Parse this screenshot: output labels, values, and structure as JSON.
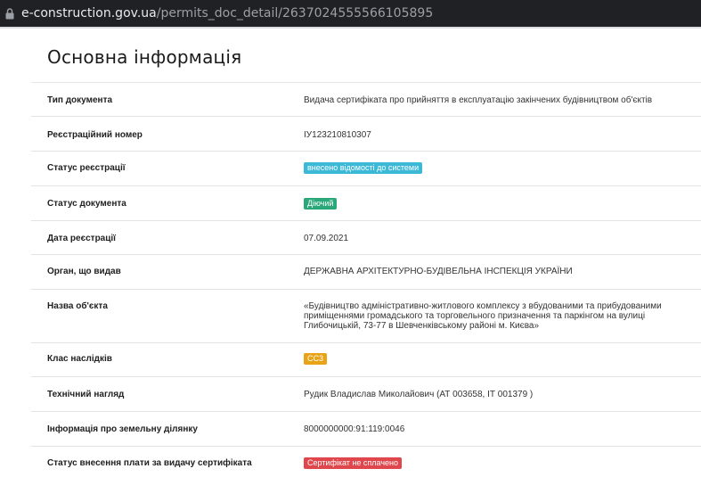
{
  "browser": {
    "url_host": "e-construction.gov.ua",
    "url_path": "/permits_doc_detail/2637024555566105895"
  },
  "page": {
    "title": "Основна інформація"
  },
  "rows": [
    {
      "label": "Тип документа",
      "value": "Видача сертифіката про прийняття в експлуатацію закінчених будівництвом об'єктів"
    },
    {
      "label": "Реєстраційний номер",
      "value": "ІУ123210810307"
    },
    {
      "label": "Статус реєстрації",
      "value": "внесено відомості до системи",
      "badge_color": "#3db9d8"
    },
    {
      "label": "Статус документа",
      "value": "Діючий",
      "badge_color": "#2aa87a"
    },
    {
      "label": "Дата реєстрації",
      "value": "07.09.2021"
    },
    {
      "label": "Орган, що видав",
      "value": "ДЕРЖАВНА АРХІТЕКТУРНО-БУДІВЕЛЬНА ІНСПЕКЦІЯ УКРАЇНИ"
    },
    {
      "label": "Назва об'єкта",
      "value": "«Будівництво адміністративно-житлового комплексу з вбудованими та прибудованими приміщеннями громадського та торговельного призначення та паркінгом на вулиці Глибочицькій, 73-77 в Шевченківському районі м. Києва»"
    },
    {
      "label": "Клас наслідків",
      "value": "СС3",
      "badge_color": "#e8a317"
    },
    {
      "label": "Технічний нагляд",
      "value": "Рудик Владислав Миколайович (АТ 003658, ІТ 001379 )"
    },
    {
      "label": "Інформація про земельну ділянку",
      "value": "8000000000:91:119:0046"
    },
    {
      "label": "Статус внесення плати за видачу сертифіката",
      "value": "Сертифікат не сплачено",
      "badge_color": "#e0474c"
    }
  ]
}
